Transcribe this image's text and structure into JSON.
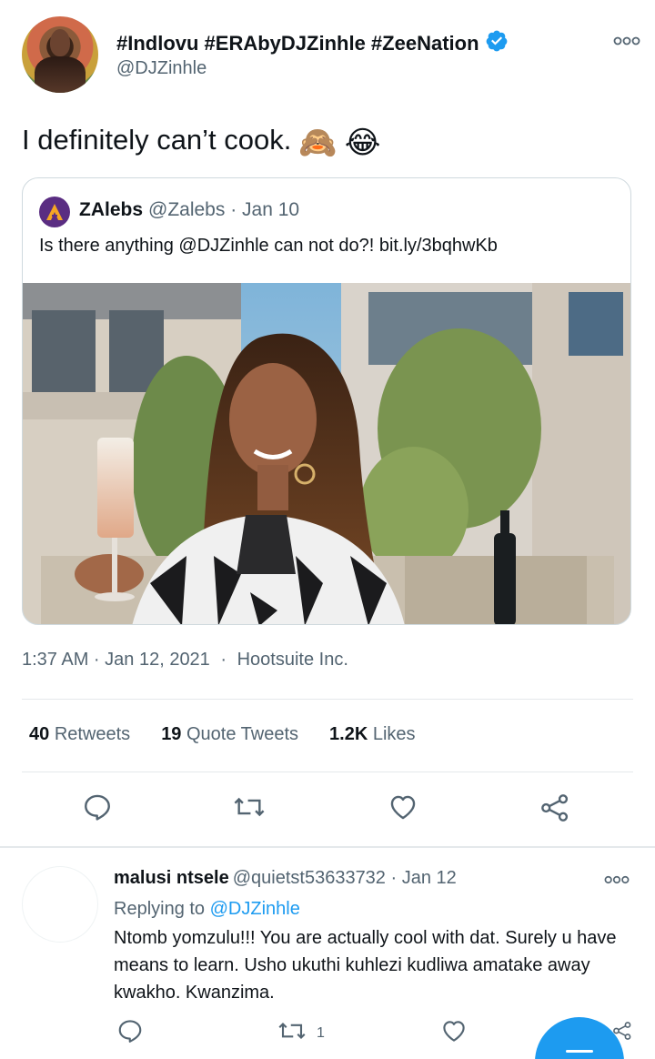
{
  "tweet": {
    "display_name": "#Indlovu #ERAbyDJZinhle #ZeeNation",
    "handle": "@DJZinhle",
    "text": "I definitely can’t cook.",
    "emojis": [
      "🙈",
      "😂"
    ],
    "timestamp": "1:37 AM · Jan 12, 2021",
    "source_sep": "·",
    "source": "Hootsuite Inc."
  },
  "quote": {
    "name": "ZAlebs",
    "handle": "@Zalebs",
    "date": "· Jan 10",
    "text": "Is there anything @DJZinhle can not do?! bit.ly/3bqhwKb"
  },
  "stats": {
    "retweets_count": "40",
    "retweets_label": "Retweets",
    "quotes_count": "19",
    "quotes_label": "Quote Tweets",
    "likes_count": "1.2K",
    "likes_label": "Likes"
  },
  "reply": {
    "name": "malusi ntsele",
    "handle": "@quietst53633732 · Jan 12",
    "replying_prefix": "Replying to",
    "replying_mention": "@DJZinhle",
    "text": "Ntomb yomzulu!!! You are actually cool with dat. Surely u have means to learn. Usho ukuthi kuhlezi kudliwa amatake away kwakho. Kwanzima.",
    "retweet_count": "1"
  },
  "icons": {
    "reply": "comment-icon",
    "retweet": "retweet-icon",
    "like": "heart-icon",
    "share": "share-icon",
    "more": "more-dots-icon",
    "verified": "verified-badge-icon"
  },
  "colors": {
    "accent": "#1d9bf0",
    "text": "#0f1419",
    "muted": "#536471",
    "border": "#cfd9de"
  }
}
